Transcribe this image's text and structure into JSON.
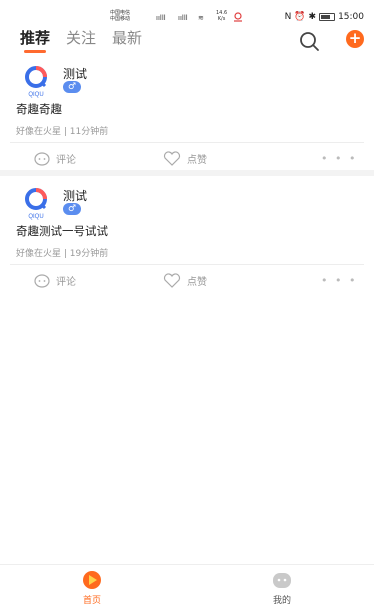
{
  "status_bar": {
    "carrier_1": "中国电信",
    "carrier_2": "中国移动",
    "speed_value": "14.6",
    "speed_unit": "K/s",
    "time": "15:00"
  },
  "tabs": [
    {
      "label": "推荐",
      "active": true
    },
    {
      "label": "关注",
      "active": false
    },
    {
      "label": "最新",
      "active": false
    }
  ],
  "header_icons": {
    "search": "search-icon",
    "add": "plus-icon"
  },
  "posts": [
    {
      "logo_text": "QIQU",
      "author": "测试",
      "gender": "♂",
      "text": "奇趣奇趣",
      "meta": "好像在火星 | 11分钟前",
      "comment_label": "评论",
      "like_label": "点赞",
      "more": "• • •"
    },
    {
      "logo_text": "QIQU",
      "author": "测试",
      "gender": "♂",
      "text": "奇趣测试一号试试",
      "meta": "好像在火星 | 19分钟前",
      "comment_label": "评论",
      "like_label": "点赞",
      "more": "• • •"
    }
  ],
  "bottom_nav": [
    {
      "label": "首页",
      "icon": "home-icon",
      "active": true
    },
    {
      "label": "我的",
      "icon": "profile-icon",
      "active": false
    }
  ],
  "colors": {
    "accent": "#ff6a1e",
    "gender_badge": "#5b8def",
    "muted": "#999999"
  }
}
